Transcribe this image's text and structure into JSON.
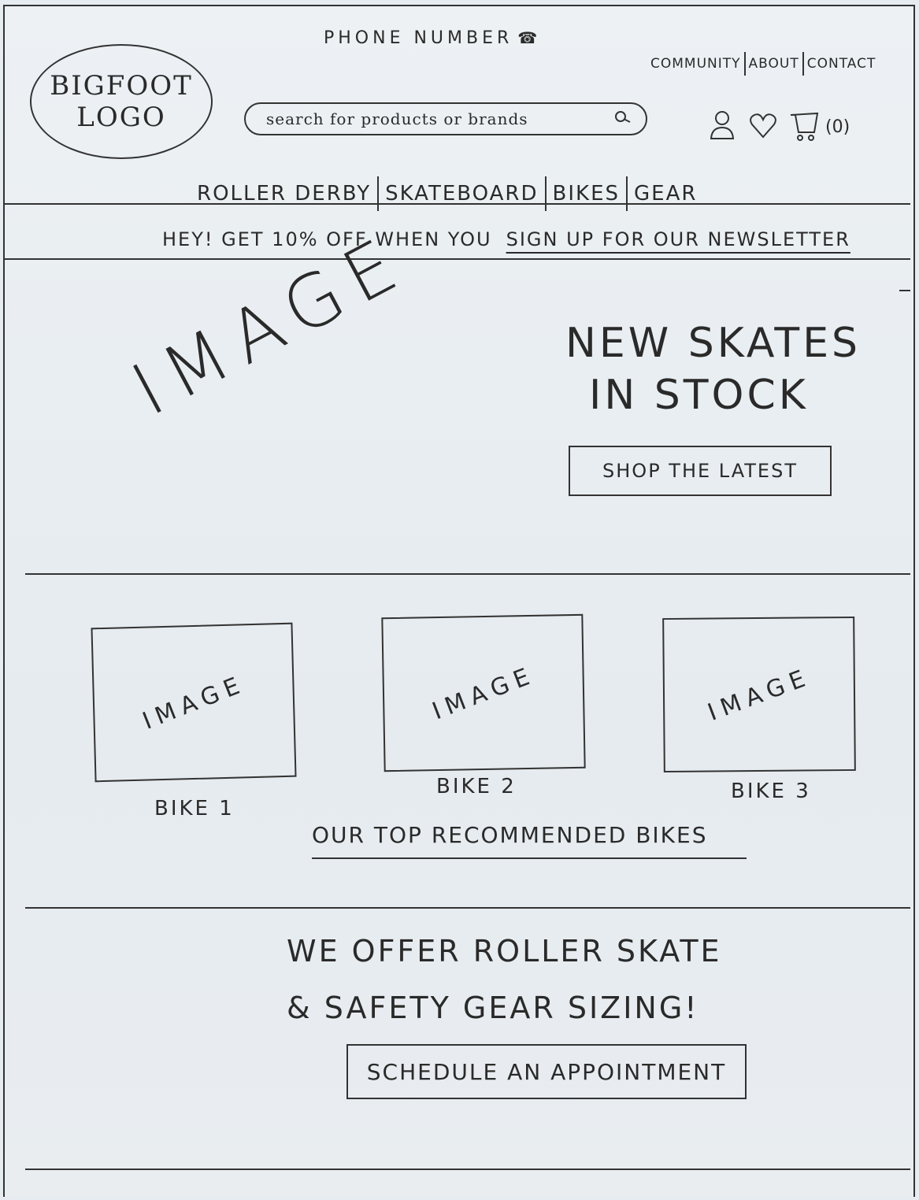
{
  "header": {
    "phone": "PHONE NUMBER",
    "util_nav": [
      "COMMUNITY",
      "ABOUT",
      "CONTACT"
    ],
    "logo_line1": "BIGFOOT",
    "logo_line2": "LOGO",
    "search_placeholder": "search for products or brands",
    "cart_count": "(0)",
    "icons": [
      "phone-icon",
      "search-icon",
      "user-icon",
      "heart-icon",
      "cart-icon"
    ]
  },
  "main_nav": [
    "ROLLER DERBY",
    "SKATEBOARD",
    "BIKES",
    "GEAR"
  ],
  "promo": {
    "text": "HEY! GET 10% OFF WHEN YOU",
    "link": "SIGN UP FOR OUR NEWSLETTER"
  },
  "hero": {
    "image_placeholder": "IMAGE",
    "title_line1": "NEW SKATES",
    "title_line2": "IN STOCK",
    "cta": "SHOP THE LATEST"
  },
  "bikes": {
    "items": [
      {
        "image": "IMAGE",
        "label": "BIKE 1"
      },
      {
        "image": "IMAGE",
        "label": "BIKE 2"
      },
      {
        "image": "IMAGE",
        "label": "BIKE 3"
      }
    ],
    "title": "OUR TOP RECOMMENDED BIKES"
  },
  "sizing": {
    "line1": "WE OFFER ROLLER SKATE",
    "line2": "& SAFETY GEAR SIZING!",
    "cta": "SCHEDULE AN APPOINTMENT"
  }
}
